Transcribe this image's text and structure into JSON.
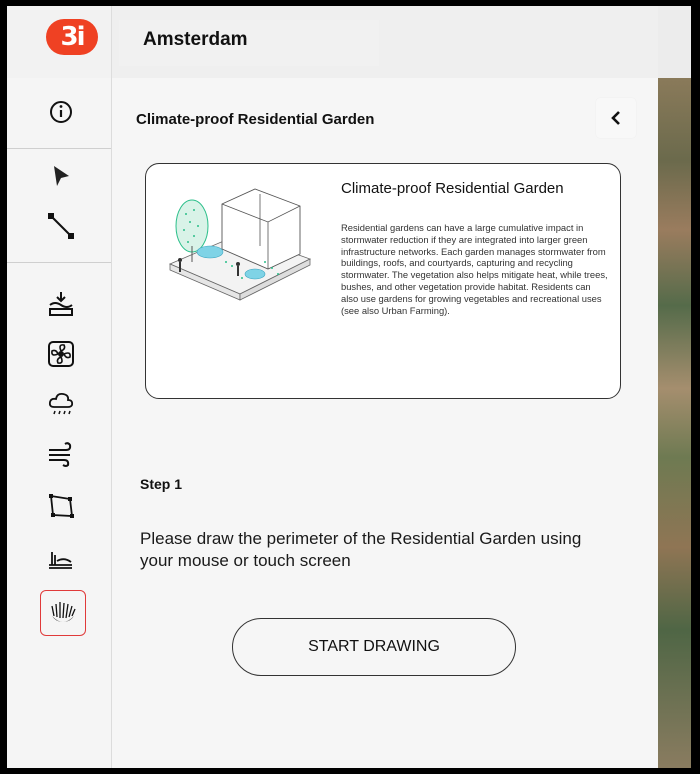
{
  "header": {
    "logo_text": "3i",
    "city": "Amsterdam"
  },
  "toolbar": {
    "tools": [
      {
        "icon": "info-icon"
      },
      {
        "icon": "pointer-icon"
      },
      {
        "icon": "line-icon"
      },
      {
        "icon": "flood-icon"
      },
      {
        "icon": "fan-icon"
      },
      {
        "icon": "rain-cloud-icon"
      },
      {
        "icon": "wind-icon"
      },
      {
        "icon": "polygon-icon"
      },
      {
        "icon": "terrain-icon"
      },
      {
        "icon": "garden-icon",
        "active": true
      }
    ],
    "active_color": "#e03a3a"
  },
  "panel": {
    "title": "Climate-proof Residential Garden",
    "card": {
      "title": "Climate-proof Residential Garden",
      "description": "Residential gardens can have a large cumulative impact in stormwater reduction if they are integrated into larger green infrastructure networks. Each garden manages stormwater from buildings, roofs, and courtyards, capturing and recycling stormwater. The vegetation also helps mitigate heat, while trees, bushes, and other vegetation provide habitat. Residents can also use gardens for growing vegetables and recreational uses (see also Urban Farming)."
    },
    "step_label": "Step 1",
    "step_text": "Please draw the perimeter of the Residential Garden using your mouse or touch screen",
    "start_button": "START DRAWING"
  },
  "colors": {
    "brand": "#ef4123",
    "illustration_green": "#2bbf8a",
    "illustration_blue": "#7fd3e6"
  }
}
